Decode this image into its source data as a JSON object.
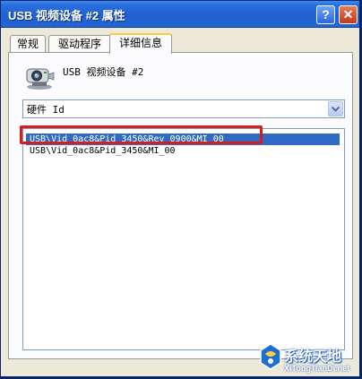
{
  "window": {
    "title": "USB 视频设备 #2 属性",
    "help_glyph": "?",
    "close_glyph": "✕"
  },
  "tabs": [
    {
      "label": "常规",
      "active": false
    },
    {
      "label": "驱动程序",
      "active": false
    },
    {
      "label": "详细信息",
      "active": true
    }
  ],
  "device": {
    "name": "USB 视频设备 #2",
    "icon": "webcam-icon"
  },
  "property_combo": {
    "value": "硬件 Id"
  },
  "values_list": [
    {
      "text": "USB\\Vid_0ac8&Pid_3450&Rev_0900&MI_00",
      "selected": true
    },
    {
      "text": "USB\\Vid_0ac8&Pid_3450&MI_00",
      "selected": false
    }
  ],
  "watermark": {
    "text_cn": "系统天地",
    "text_en": "XiTongTianDi.net"
  },
  "colors": {
    "title_bar": "#2466d2",
    "selection": "#316ac5",
    "annotation_box": "#d51f1f",
    "active_tab_accent": "#ffc83c"
  }
}
